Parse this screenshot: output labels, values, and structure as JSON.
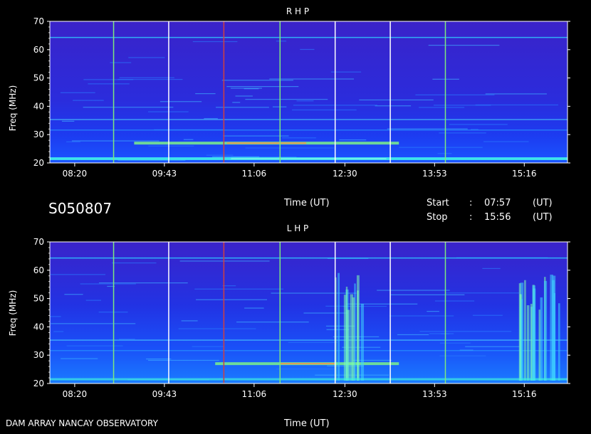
{
  "observation_id": "S050807",
  "footer": {
    "instrument": "DAM ARRAY   NANCAY OBSERVATORY",
    "time_label": "Time (UT)"
  },
  "time_info": {
    "time_label": "Time (UT)",
    "start_label": "Start",
    "start_sep": ":",
    "start_value": "07:57",
    "start_unit": "(UT)",
    "stop_label": "Stop",
    "stop_sep": ":",
    "stop_value": "15:56",
    "stop_unit": "(UT)"
  },
  "colors": {
    "background": "#000000",
    "frame": "#ffffff",
    "base_blue": "#1c23e6"
  },
  "chart_data": [
    {
      "type": "heatmap",
      "title": "R H P",
      "ylabel": "Freq (MHz)",
      "xlabel": "",
      "ylim": [
        20,
        70
      ],
      "y_ticks": [
        "70",
        "60",
        "50",
        "40",
        "30",
        "20"
      ],
      "x_ticks": [
        "08:20",
        "09:43",
        "11:06",
        "12:30",
        "13:53",
        "15:16"
      ],
      "x_range": [
        "07:57",
        "15:56"
      ],
      "vertical_markers": [
        {
          "time": "08:56",
          "color": "#7de87d"
        },
        {
          "time": "09:47",
          "color": "#ffffff"
        },
        {
          "time": "10:38",
          "color": "#d04040"
        },
        {
          "time": "11:30",
          "color": "#7de87d"
        },
        {
          "time": "12:21",
          "color": "#ffffff"
        },
        {
          "time": "13:12",
          "color": "#ffffff"
        },
        {
          "time": "14:03",
          "color": "#7de87d"
        }
      ],
      "features": [
        {
          "name": "Horizontal emission band",
          "freq_mhz": 27,
          "start": "09:15",
          "end": "13:20",
          "intensity": "high"
        },
        {
          "name": "Low-frequency cutoff band",
          "freq_mhz": 21.5,
          "start": "07:57",
          "end": "15:56",
          "intensity": "medium"
        }
      ]
    },
    {
      "type": "heatmap",
      "title": "L H P",
      "ylabel": "Freq (MHz)",
      "xlabel": "Time (UT)",
      "ylim": [
        20,
        70
      ],
      "y_ticks": [
        "70",
        "60",
        "50",
        "40",
        "30",
        "20"
      ],
      "x_ticks": [
        "08:20",
        "09:43",
        "11:06",
        "12:30",
        "13:53",
        "15:16"
      ],
      "x_range": [
        "07:57",
        "15:56"
      ],
      "vertical_markers": [
        {
          "time": "08:56",
          "color": "#7de87d"
        },
        {
          "time": "09:47",
          "color": "#ffffff"
        },
        {
          "time": "10:38",
          "color": "#d04040"
        },
        {
          "time": "11:30",
          "color": "#7de87d"
        },
        {
          "time": "12:21",
          "color": "#ffffff"
        },
        {
          "time": "13:12",
          "color": "#ffffff"
        },
        {
          "time": "14:03",
          "color": "#7de87d"
        }
      ],
      "features": [
        {
          "name": "Horizontal emission band",
          "freq_mhz": 27,
          "start": "10:30",
          "end": "13:20",
          "intensity": "high"
        },
        {
          "name": "Burst cluster",
          "freq_mhz": 45,
          "start": "12:20",
          "end": "12:45",
          "intensity": "medium"
        },
        {
          "name": "Burst cluster",
          "freq_mhz": 40,
          "start": "15:10",
          "end": "15:50",
          "intensity": "high"
        }
      ]
    }
  ]
}
